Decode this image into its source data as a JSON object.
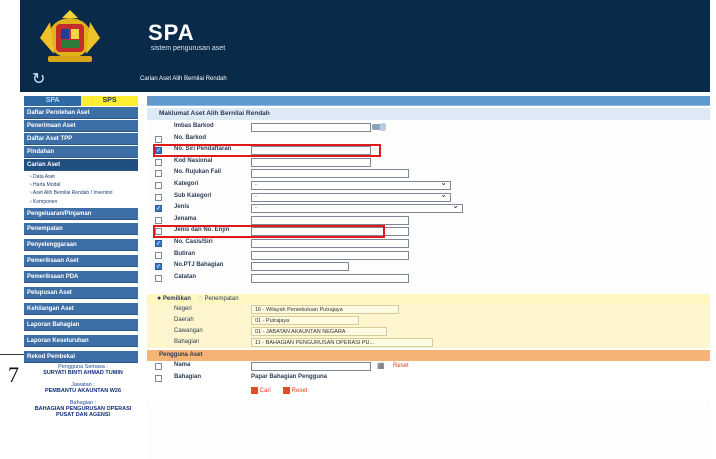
{
  "header": {
    "title": "SPA",
    "subtitle": "sistem pengurusan aset",
    "breadcrumb": "Carian Aset Alih Bernilai Rendah"
  },
  "sidebar": {
    "tabs": [
      "SPA",
      "SPS"
    ],
    "items": [
      "Daftar Perolehan Aset",
      "Penerimaan Aset",
      "Daftar Aset TPP",
      "Pindahan",
      "Carian Aset",
      "Pengeluaran/Pinjaman",
      "Penempatan",
      "Penyelenggaraan",
      "Pemeriksaan Aset",
      "Pemeriksaan PDA",
      "Pelupusan Aset",
      "Kehilangan Aset",
      "Laporan Bahagian",
      "Laporan Keseluruhan",
      "Rekod Pembekal"
    ],
    "subitems": [
      "› Data Aset",
      "› Harta Modal",
      "› Aset Alih Bernilai Rendah / Inventori",
      "› Komponen"
    ],
    "user": {
      "label_user": "Pengguna Semasa :",
      "user_name": "SURYATI BINTI AHMAD TUMIN",
      "label_post": "Jawatan :",
      "post": "PEMBANTU AKAUNTAN W26",
      "label_dept": "Bahagian :",
      "dept": "BAHAGIAN PENGURUSAN OPERASI PUSAT DAN AGENSI"
    }
  },
  "form": {
    "section_title": "Maklumat Aset Alih Bernilai Rendah",
    "fields": [
      {
        "label": "Imbas Barkod",
        "checked": false,
        "type": "input",
        "value": ""
      },
      {
        "label": "No. Barkod",
        "checked": false,
        "type": "none",
        "value": ""
      },
      {
        "label": "No. Siri Pendaftaran",
        "checked": true,
        "type": "input",
        "value": ""
      },
      {
        "label": "Kod Nasional",
        "checked": false,
        "type": "input",
        "value": ""
      },
      {
        "label": "No. Rujukan Fail",
        "checked": false,
        "type": "input",
        "value": ""
      },
      {
        "label": "Kategori",
        "checked": false,
        "type": "select",
        "value": "-"
      },
      {
        "label": "Sub Kategori",
        "checked": false,
        "type": "select",
        "value": "-"
      },
      {
        "label": "Jenis",
        "checked": true,
        "type": "select",
        "value": "-"
      },
      {
        "label": "Jenama",
        "checked": false,
        "type": "input",
        "value": ""
      },
      {
        "label": "Jenis dan No. Enjin",
        "checked": false,
        "type": "input",
        "value": ""
      },
      {
        "label": "No. Casis/Siri",
        "checked": true,
        "type": "input",
        "value": ""
      },
      {
        "label": "Butiran",
        "checked": false,
        "type": "input",
        "value": ""
      },
      {
        "label": "No.PTJ Bahagian",
        "checked": true,
        "type": "input",
        "value": ""
      },
      {
        "label": "Catatan",
        "checked": false,
        "type": "input",
        "value": ""
      }
    ]
  },
  "ownership": {
    "radio1": "Pemilikan",
    "radio2": "Penempatan",
    "rows": [
      {
        "label": "Negeri",
        "value": "16 - Wilayah Persekutuan Putrajaya"
      },
      {
        "label": "Daerah",
        "value": "01 - Putrajaya"
      },
      {
        "label": "Cawangan",
        "value": "01 - JABATAN AKAUNTAN NEGARA"
      },
      {
        "label": "Bahagian",
        "value": "11 - BAHAGIAN PENGURUSAN OPERASI PU..."
      }
    ]
  },
  "pengguna": {
    "title": "Pengguna Aset",
    "nama_label": "Nama",
    "reset_label": "Reset",
    "bahagian_label": "Bahagian",
    "bahagian_value": "Papar Bahagian Pengguna",
    "cari_label": "Cari",
    "reset2_label": "Reset"
  },
  "page_number": "7"
}
